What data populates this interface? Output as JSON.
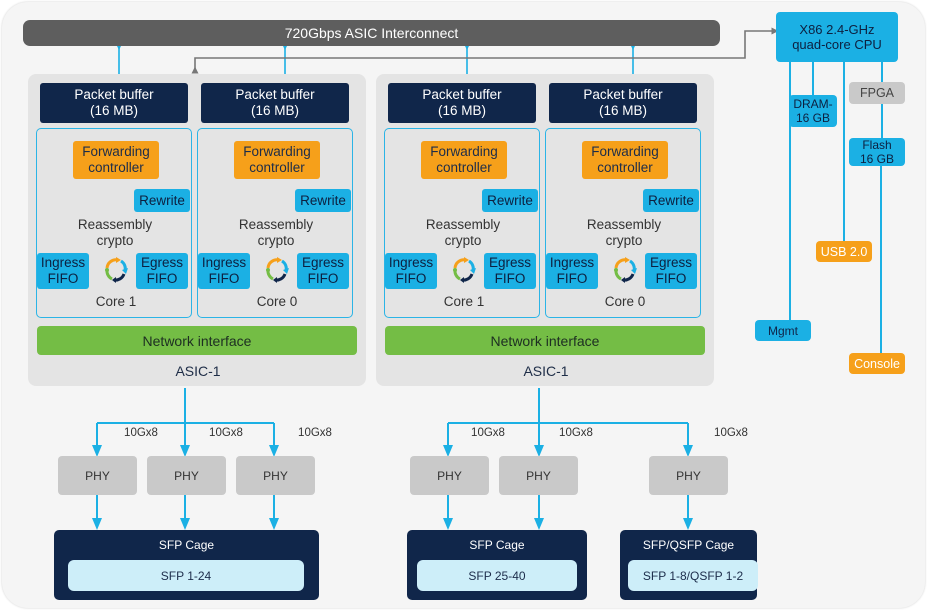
{
  "interconnect": {
    "label": "720Gbps ASIC Interconnect"
  },
  "asics": [
    {
      "label": "ASIC-1",
      "network_interface": "Network interface",
      "cores": [
        {
          "packet_buffer": "Packet buffer\n(16 MB)",
          "forwarding": "Forwarding controller",
          "rewrite": "Rewrite",
          "reassembly": "Reassembly crypto",
          "ingress": "Ingress FIFO",
          "egress": "Egress FIFO",
          "name": "Core 1"
        },
        {
          "packet_buffer": "Packet buffer\n(16 MB)",
          "forwarding": "Forwarding controller",
          "rewrite": "Rewrite",
          "reassembly": "Reassembly crypto",
          "ingress": "Ingress FIFO",
          "egress": "Egress FIFO",
          "name": "Core 0"
        }
      ]
    },
    {
      "label": "ASIC-1",
      "network_interface": "Network interface",
      "cores": [
        {
          "packet_buffer": "Packet buffer\n(16 MB)",
          "forwarding": "Forwarding controller",
          "rewrite": "Rewrite",
          "reassembly": "Reassembly crypto",
          "ingress": "Ingress FIFO",
          "egress": "Egress FIFO",
          "name": "Core 1"
        },
        {
          "packet_buffer": "Packet buffer\n(16 MB)",
          "forwarding": "Forwarding controller",
          "rewrite": "Rewrite",
          "reassembly": "Reassembly crypto",
          "ingress": "Ingress FIFO",
          "egress": "Egress FIFO",
          "name": "Core 0"
        }
      ]
    }
  ],
  "phy_groups": [
    {
      "links": [
        "10Gx8",
        "10Gx8",
        "10Gx8"
      ],
      "phys": [
        "PHY",
        "PHY",
        "PHY"
      ]
    },
    {
      "links": [
        "10Gx8",
        "10Gx8",
        "10Gx8"
      ],
      "phys": [
        "PHY",
        "PHY",
        "PHY"
      ]
    }
  ],
  "cages": [
    {
      "title": "SFP Cage",
      "ports": "SFP 1-24"
    },
    {
      "title": "SFP Cage",
      "ports": "SFP 25-40"
    },
    {
      "title": "SFP/QSFP Cage",
      "ports": "SFP 1-8/QSFP 1-2"
    }
  ],
  "cpu": {
    "label": "X86 2.4-GHz\nquad-core CPU",
    "dram": "DRAM-\n16 GB",
    "fpga": "FPGA",
    "flash": "Flash\n16 GB",
    "usb": "USB 2.0",
    "mgmt": "Mgmt",
    "console": "Console"
  },
  "colors": {
    "navy": "#10264a",
    "cyan": "#1bb0e4",
    "orange": "#f6a01a",
    "green": "#74bd45",
    "gray": "#c9c9c9",
    "bus": "#5e5e5e"
  }
}
